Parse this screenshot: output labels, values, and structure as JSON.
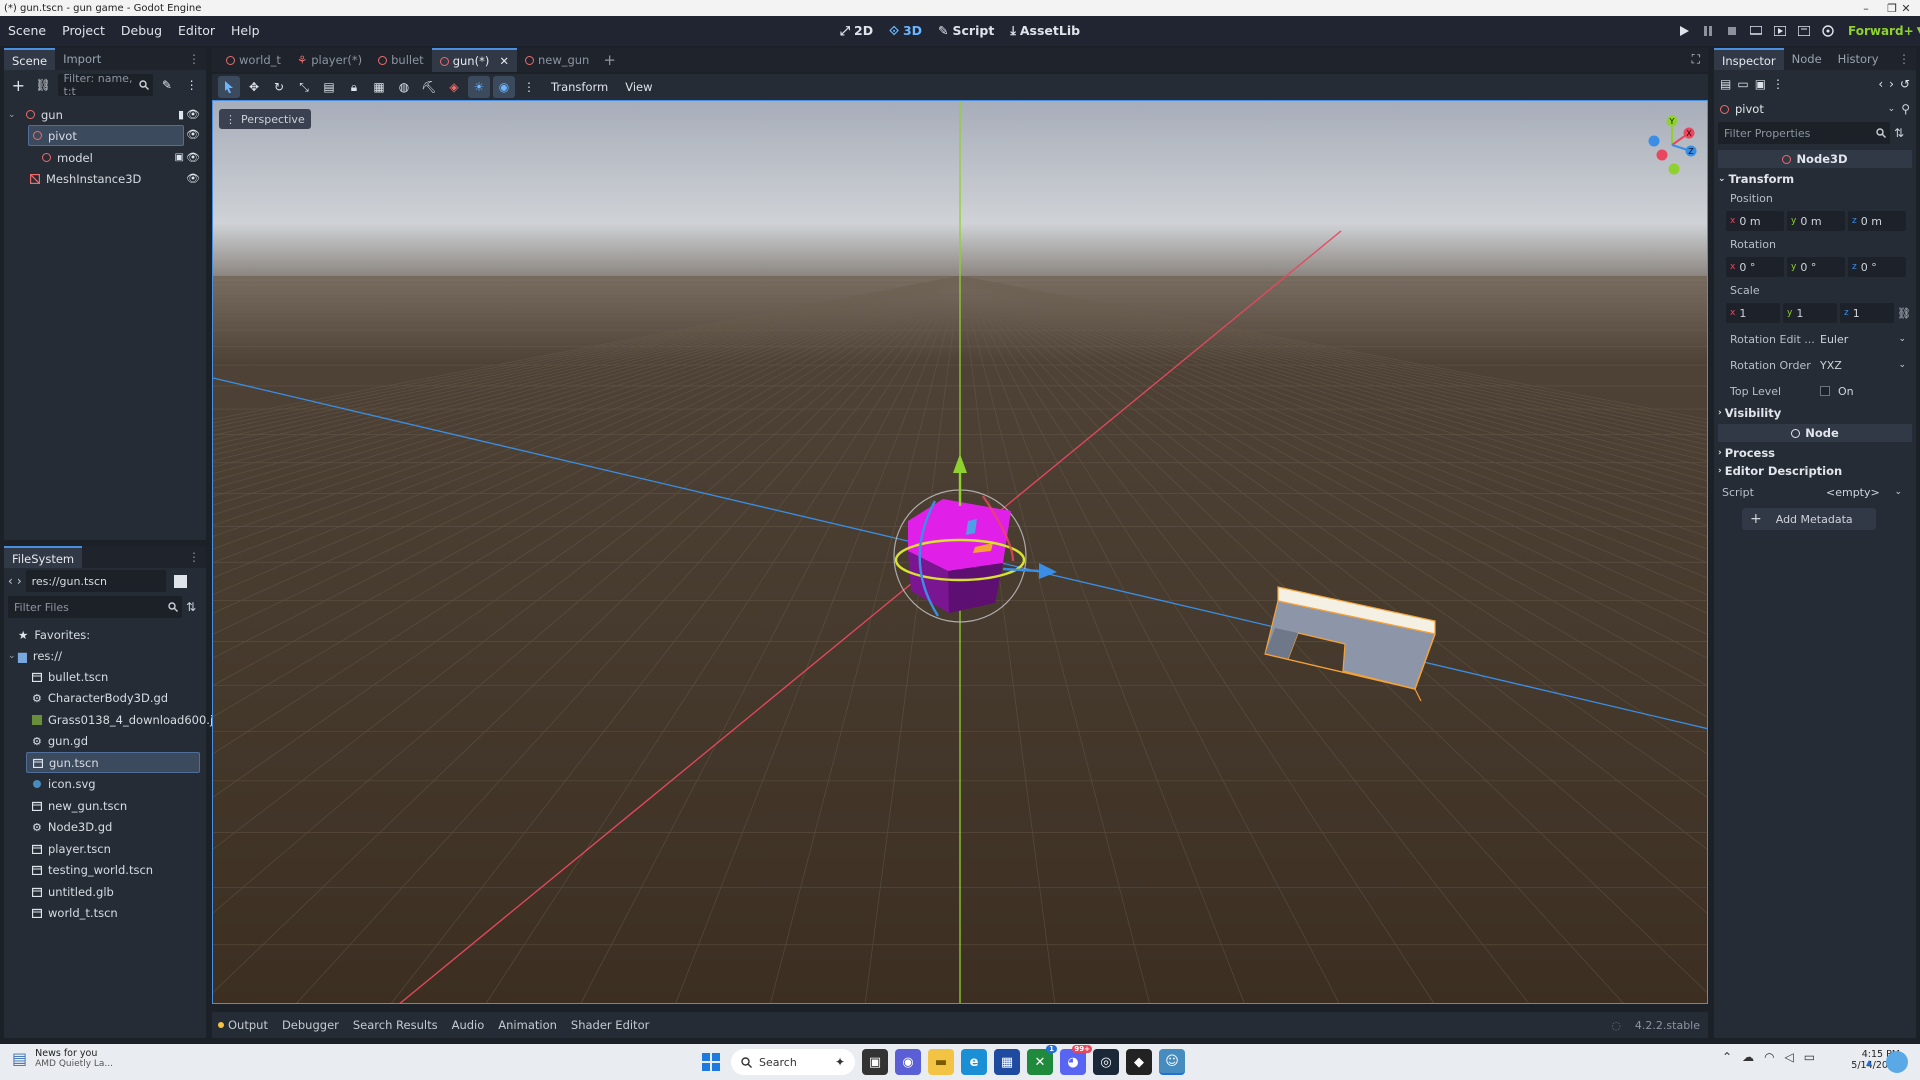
{
  "window": {
    "title": "(*) gun.tscn - gun game - Godot Engine",
    "minimize": "–",
    "maximize": "❐",
    "close": "✕"
  },
  "menu": {
    "items": [
      "Scene",
      "Project",
      "Debug",
      "Editor",
      "Help"
    ]
  },
  "workspaces": [
    "2D",
    "3D",
    "Script",
    "AssetLib"
  ],
  "renderer": "Forward+",
  "scene_dock": {
    "tabs": [
      "Scene",
      "Import"
    ],
    "filter_placeholder": "Filter: name, t:t",
    "nodes": [
      {
        "label": "gun",
        "depth": 0,
        "icon": "node3d-icon"
      },
      {
        "label": "pivot",
        "depth": 1,
        "icon": "node3d-icon",
        "selected": true
      },
      {
        "label": "model",
        "depth": 2,
        "icon": "node3d-icon"
      },
      {
        "label": "MeshInstance3D",
        "depth": 1,
        "icon": "mesh-icon"
      }
    ]
  },
  "filesystem": {
    "tab": "FileSystem",
    "path": "res://gun.tscn",
    "filter_placeholder": "Filter Files",
    "favorites": "Favorites:",
    "root": "res://",
    "files": [
      {
        "name": "bullet.tscn",
        "icon": "scene-icon"
      },
      {
        "name": "CharacterBody3D.gd",
        "icon": "gear-icon"
      },
      {
        "name": "Grass0138_4_download600.j...",
        "icon": "image-icon"
      },
      {
        "name": "gun.gd",
        "icon": "gear-icon"
      },
      {
        "name": "gun.tscn",
        "icon": "scene-icon",
        "selected": true
      },
      {
        "name": "icon.svg",
        "icon": "svg-icon"
      },
      {
        "name": "new_gun.tscn",
        "icon": "scene-icon"
      },
      {
        "name": "Node3D.gd",
        "icon": "gear-icon"
      },
      {
        "name": "player.tscn",
        "icon": "scene-icon"
      },
      {
        "name": "testing_world.tscn",
        "icon": "scene-icon"
      },
      {
        "name": "untitled.glb",
        "icon": "scene-icon"
      },
      {
        "name": "world_t.tscn",
        "icon": "scene-icon"
      }
    ]
  },
  "editor_tabs": [
    {
      "label": "world_t",
      "icon": "ring"
    },
    {
      "label": "player(*)",
      "icon": "character"
    },
    {
      "label": "bullet",
      "icon": "ring"
    },
    {
      "label": "gun(*)",
      "icon": "ring",
      "active": true,
      "close": "✕"
    },
    {
      "label": "new_gun",
      "icon": "ring"
    }
  ],
  "viewport_toolbar": {
    "transform_menu": "Transform",
    "view_menu": "View"
  },
  "viewport": {
    "perspective_label": "Perspective",
    "gizmo": {
      "x": "X",
      "y": "Y",
      "z": "Z"
    }
  },
  "inspector": {
    "tabs": [
      "Inspector",
      "Node",
      "History"
    ],
    "object": "pivot",
    "filter_placeholder": "Filter Properties",
    "class_name": "Node3D",
    "transform_section": "Transform",
    "position_label": "Position",
    "position": {
      "x": "0 m",
      "y": "0 m",
      "z": "0 m"
    },
    "rotation_label": "Rotation",
    "rotation": {
      "x": "0 °",
      "y": "0 °",
      "z": "0 °"
    },
    "scale_label": "Scale",
    "scale": {
      "x": "1",
      "y": "1",
      "z": "1"
    },
    "axis_letters": {
      "x": "x",
      "y": "y",
      "z": "z"
    },
    "rotation_edit_label": "Rotation Edit ...",
    "rotation_edit_value": "Euler",
    "rotation_order_label": "Rotation Order",
    "rotation_order_value": "YXZ",
    "top_level_label": "Top Level",
    "top_level_value": "On",
    "visibility_section": "Visibility",
    "node_class": "Node",
    "process_section": "Process",
    "editor_description_section": "Editor Description",
    "script_label": "Script",
    "script_value": "<empty>",
    "add_metadata": "Add Metadata"
  },
  "bottom_panel": {
    "tabs": [
      "Output",
      "Debugger",
      "Search Results",
      "Audio",
      "Animation",
      "Shader Editor"
    ],
    "version": "4.2.2.stable"
  },
  "taskbar": {
    "news_title": "News for you",
    "news_sub": "AMD Quietly La...",
    "search_placeholder": "Search",
    "time": "4:15 PM",
    "date": "5/14/2024",
    "discord_badge": "99+",
    "xbox_badge": "1"
  },
  "colors": {
    "accent": "#4a90e2",
    "x_axis": "#e8475f",
    "y_axis": "#8fd12e",
    "z_axis": "#3a8ee6",
    "selection": "#f7a239"
  }
}
